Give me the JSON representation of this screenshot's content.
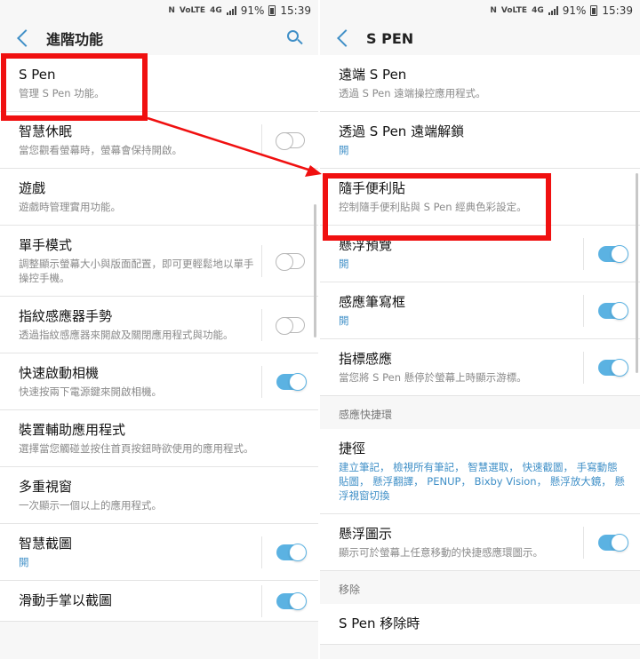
{
  "status_bar": {
    "nfc": "N",
    "volte": "VoLTE",
    "network": "4G",
    "battery": "91%",
    "time": "15:39"
  },
  "left": {
    "title": "進階功能",
    "items": [
      {
        "title": "S Pen",
        "subtitle": "管理 S Pen 功能。",
        "toggle": null
      },
      {
        "title": "智慧休眠",
        "subtitle": "當您觀看螢幕時，螢幕會保持開啟。",
        "toggle": "off"
      },
      {
        "title": "遊戲",
        "subtitle": "遊戲時管理實用功能。",
        "toggle": null
      },
      {
        "title": "單手模式",
        "subtitle": "調整顯示螢幕大小與版面配置，即可更輕鬆地以單手操控手機。",
        "toggle": "off"
      },
      {
        "title": "指紋感應器手勢",
        "subtitle": "透過指紋感應器來開啟及關閉應用程式與功能。",
        "toggle": "off"
      },
      {
        "title": "快速啟動相機",
        "subtitle": "快速按兩下電源鍵來開啟相機。",
        "toggle": "on"
      },
      {
        "title": "裝置輔助應用程式",
        "subtitle": "選擇當您觸碰並按住首頁按鈕時欲使用的應用程式。",
        "toggle": null
      },
      {
        "title": "多重視窗",
        "subtitle": "一次顯示一個以上的應用程式。",
        "toggle": null
      },
      {
        "title": "智慧截圖",
        "subtitle": "開",
        "subtitle_blue": true,
        "toggle": "on"
      },
      {
        "title": "滑動手掌以截圖",
        "subtitle": "",
        "toggle": "on"
      }
    ]
  },
  "right": {
    "title": "S PEN",
    "items": [
      {
        "title": "遠端 S Pen",
        "subtitle": "透過 S Pen 遠端操控應用程式。",
        "toggle": null
      },
      {
        "title": "透過 S Pen 遠端解鎖",
        "subtitle": "開",
        "subtitle_blue": true,
        "toggle": null
      },
      {
        "title": "隨手便利貼",
        "subtitle": "控制隨手便利貼與 S Pen 經典色彩設定。",
        "toggle": null
      },
      {
        "title": "懸浮預覽",
        "subtitle": "開",
        "subtitle_blue": true,
        "toggle": "on"
      },
      {
        "title": "感應筆寫框",
        "subtitle": "開",
        "subtitle_blue": true,
        "toggle": "on"
      },
      {
        "title": "指標感應",
        "subtitle": "當您將 S Pen 懸停於螢幕上時顯示游標。",
        "toggle": "on"
      }
    ],
    "section1": "感應快捷環",
    "items2": [
      {
        "title": "捷徑",
        "subtitle": "建立筆記， 檢視所有筆記， 智慧選取， 快速截圖， 手寫動態貼圖， 懸浮翻譯， PENUP， Bixby Vision， 懸浮放大鏡， 懸浮視窗切換",
        "subtitle_blue": true,
        "toggle": null
      },
      {
        "title": "懸浮圖示",
        "subtitle": "顯示可於螢幕上任意移動的快捷感應環圖示。",
        "toggle": "on"
      }
    ],
    "section2": "移除",
    "items3": [
      {
        "title": "S Pen 移除時",
        "subtitle": "",
        "toggle": null
      }
    ]
  },
  "colors": {
    "accent": "#3f8fc7",
    "toggle_on": "#5bb2e2",
    "highlight": "#f01010"
  }
}
